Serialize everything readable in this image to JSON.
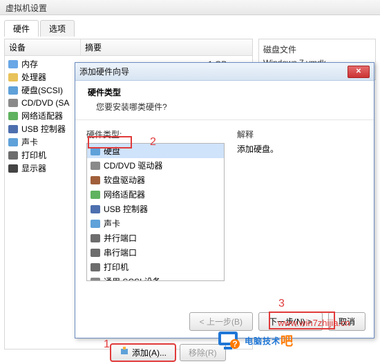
{
  "window_title": "虚拟机设置",
  "tabs": {
    "hardware": "硬件",
    "options": "选项"
  },
  "columns": {
    "device": "设备",
    "summary": "摘要"
  },
  "devices": [
    {
      "name": "内存",
      "summary": "1 GB",
      "ic": "ic-mem"
    },
    {
      "name": "处理器",
      "summary": "",
      "ic": "ic-cpu"
    },
    {
      "name": "硬盘(SCSI)",
      "summary": "",
      "ic": "ic-hdd"
    },
    {
      "name": "CD/DVD (SA",
      "summary": "",
      "ic": "ic-cd"
    },
    {
      "name": "网络适配器",
      "summary": "",
      "ic": "ic-net"
    },
    {
      "name": "USB 控制器",
      "summary": "",
      "ic": "ic-usb"
    },
    {
      "name": "声卡",
      "summary": "",
      "ic": "ic-snd"
    },
    {
      "name": "打印机",
      "summary": "",
      "ic": "ic-prn"
    },
    {
      "name": "显示器",
      "summary": "",
      "ic": "ic-dsp"
    }
  ],
  "disk_panel": {
    "title": "磁盘文件",
    "value": "Windows 7.vmdk"
  },
  "wizard": {
    "title": "添加硬件向导",
    "head_title": "硬件类型",
    "head_sub": "您要安装哪类硬件?",
    "list_label": "硬件类型:",
    "explain_label": "解释",
    "explain_text": "添加硬盘。",
    "items": [
      {
        "name": "硬盘",
        "ic": "ic-hdd",
        "selected": true
      },
      {
        "name": "CD/DVD 驱动器",
        "ic": "ic-cd"
      },
      {
        "name": "软盘驱动器",
        "ic": "ic-fdd"
      },
      {
        "name": "网络适配器",
        "ic": "ic-net"
      },
      {
        "name": "USB 控制器",
        "ic": "ic-usb"
      },
      {
        "name": "声卡",
        "ic": "ic-snd"
      },
      {
        "name": "并行端口",
        "ic": "ic-prn"
      },
      {
        "name": "串行端口",
        "ic": "ic-prn"
      },
      {
        "name": "打印机",
        "ic": "ic-prn"
      },
      {
        "name": "通用 SCSI 设备",
        "ic": "ic-scsi"
      }
    ],
    "back": "< 上一步(B)",
    "next": "下一步(N) >",
    "cancel": "取消"
  },
  "bottom": {
    "add": "添加(A)...",
    "remove": "移除(R)"
  },
  "annotations": {
    "n1": "1",
    "n2": "2",
    "n3": "3"
  },
  "watermark": {
    "url": "www.win7zhijia.cn",
    "text_a": "电脑技术",
    "text_b": "吧"
  }
}
